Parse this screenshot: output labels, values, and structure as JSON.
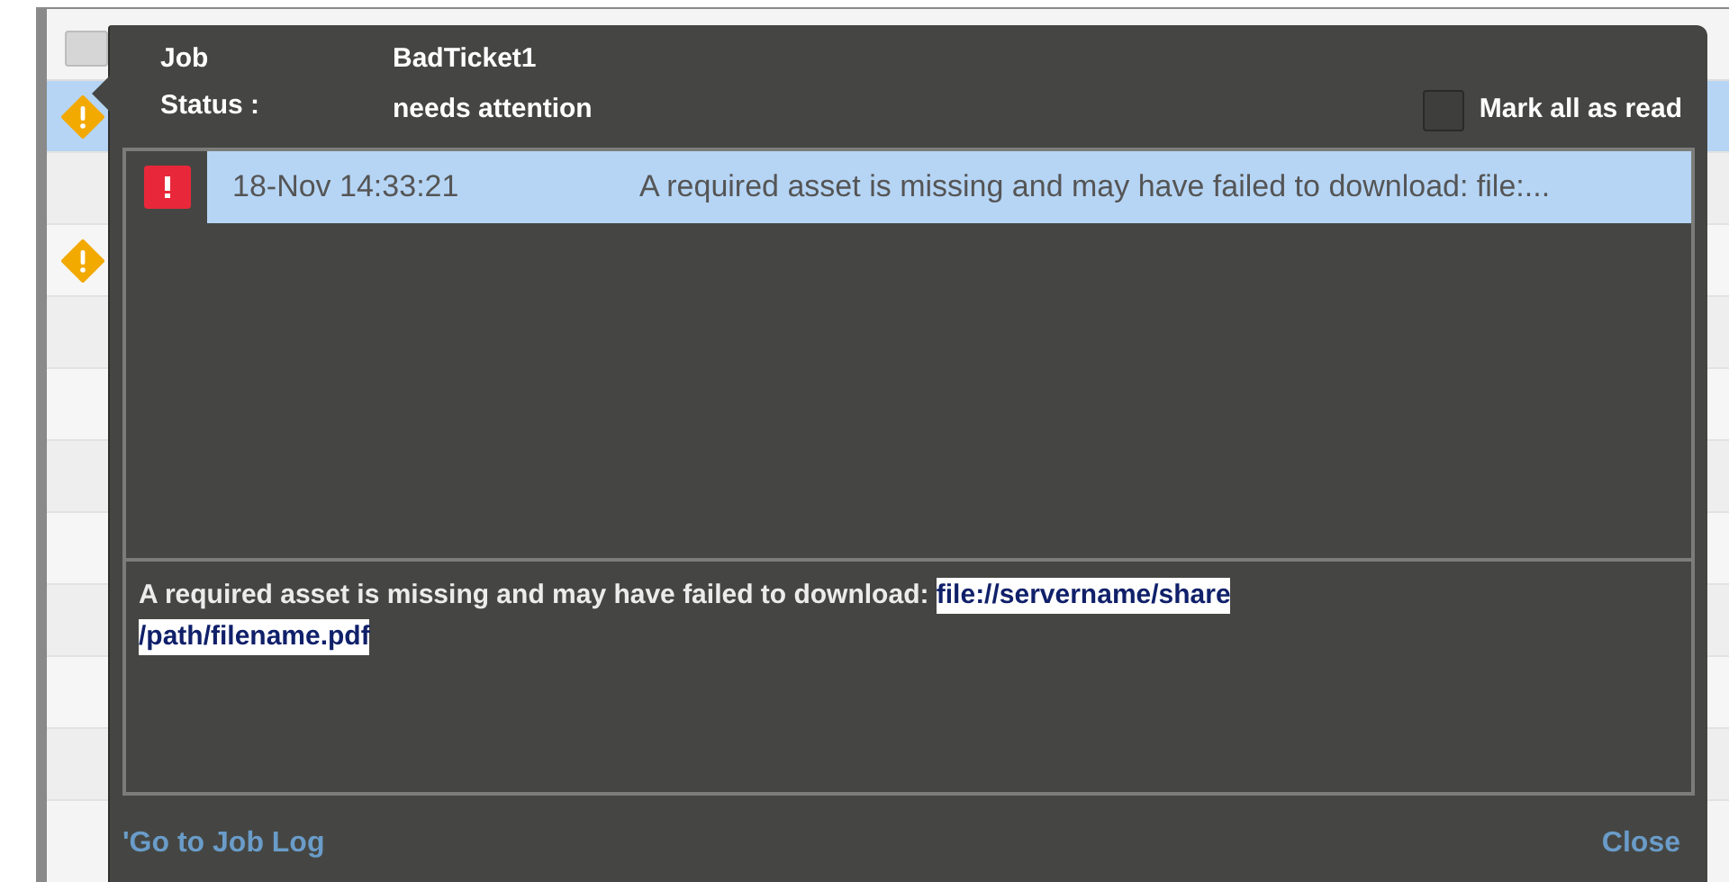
{
  "background_list": {
    "header_checkbox": {
      "checked": false
    },
    "rows": [
      {
        "warning": true,
        "selected": true
      },
      {
        "warning": false,
        "selected": false
      },
      {
        "warning": true,
        "selected": false
      },
      {
        "warning": false,
        "selected": false
      },
      {
        "warning": false,
        "selected": false
      },
      {
        "warning": false,
        "selected": false
      },
      {
        "warning": false,
        "selected": false
      },
      {
        "warning": false,
        "selected": false
      },
      {
        "warning": false,
        "selected": false
      },
      {
        "warning": false,
        "selected": false
      }
    ]
  },
  "popup": {
    "job_label": "Job",
    "job_value": "BadTicket1",
    "status_label": "Status :",
    "status_value": "needs attention",
    "mark_all_as_read": {
      "label": "Mark all as read",
      "checked": false
    },
    "messages": [
      {
        "kind": "error",
        "time": "18-Nov 14:33:21",
        "text": "A required asset is missing and may have failed to download: file:...",
        "selected": true
      }
    ],
    "detail": {
      "text": "A required asset is missing and may have failed to download: ",
      "selection": [
        "file://servername/share",
        "/path/filename.pdf"
      ]
    },
    "footer": {
      "job_log_link": "'Go to Job Log",
      "close_link": "Close"
    }
  }
}
